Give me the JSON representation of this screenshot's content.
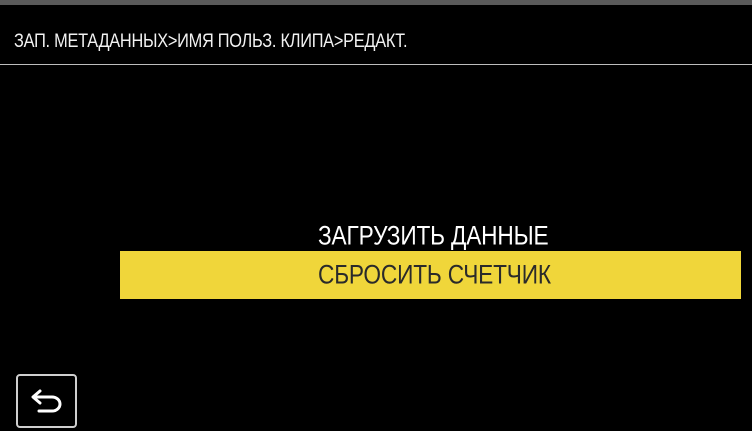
{
  "header": {
    "title": "ЗАП. МЕТАДАННЫХ>ИМЯ ПОЛЬЗ. КЛИПА>РЕДАКТ."
  },
  "menu": {
    "items": [
      {
        "label": "ЗАГРУЗИТЬ ДАННЫЕ",
        "selected": false
      },
      {
        "label": "СБРОСИТЬ СЧЕТЧИК",
        "selected": true
      }
    ],
    "highlight_color": "#f0d63a"
  },
  "footer": {
    "back_icon": "return-arrow-icon"
  }
}
